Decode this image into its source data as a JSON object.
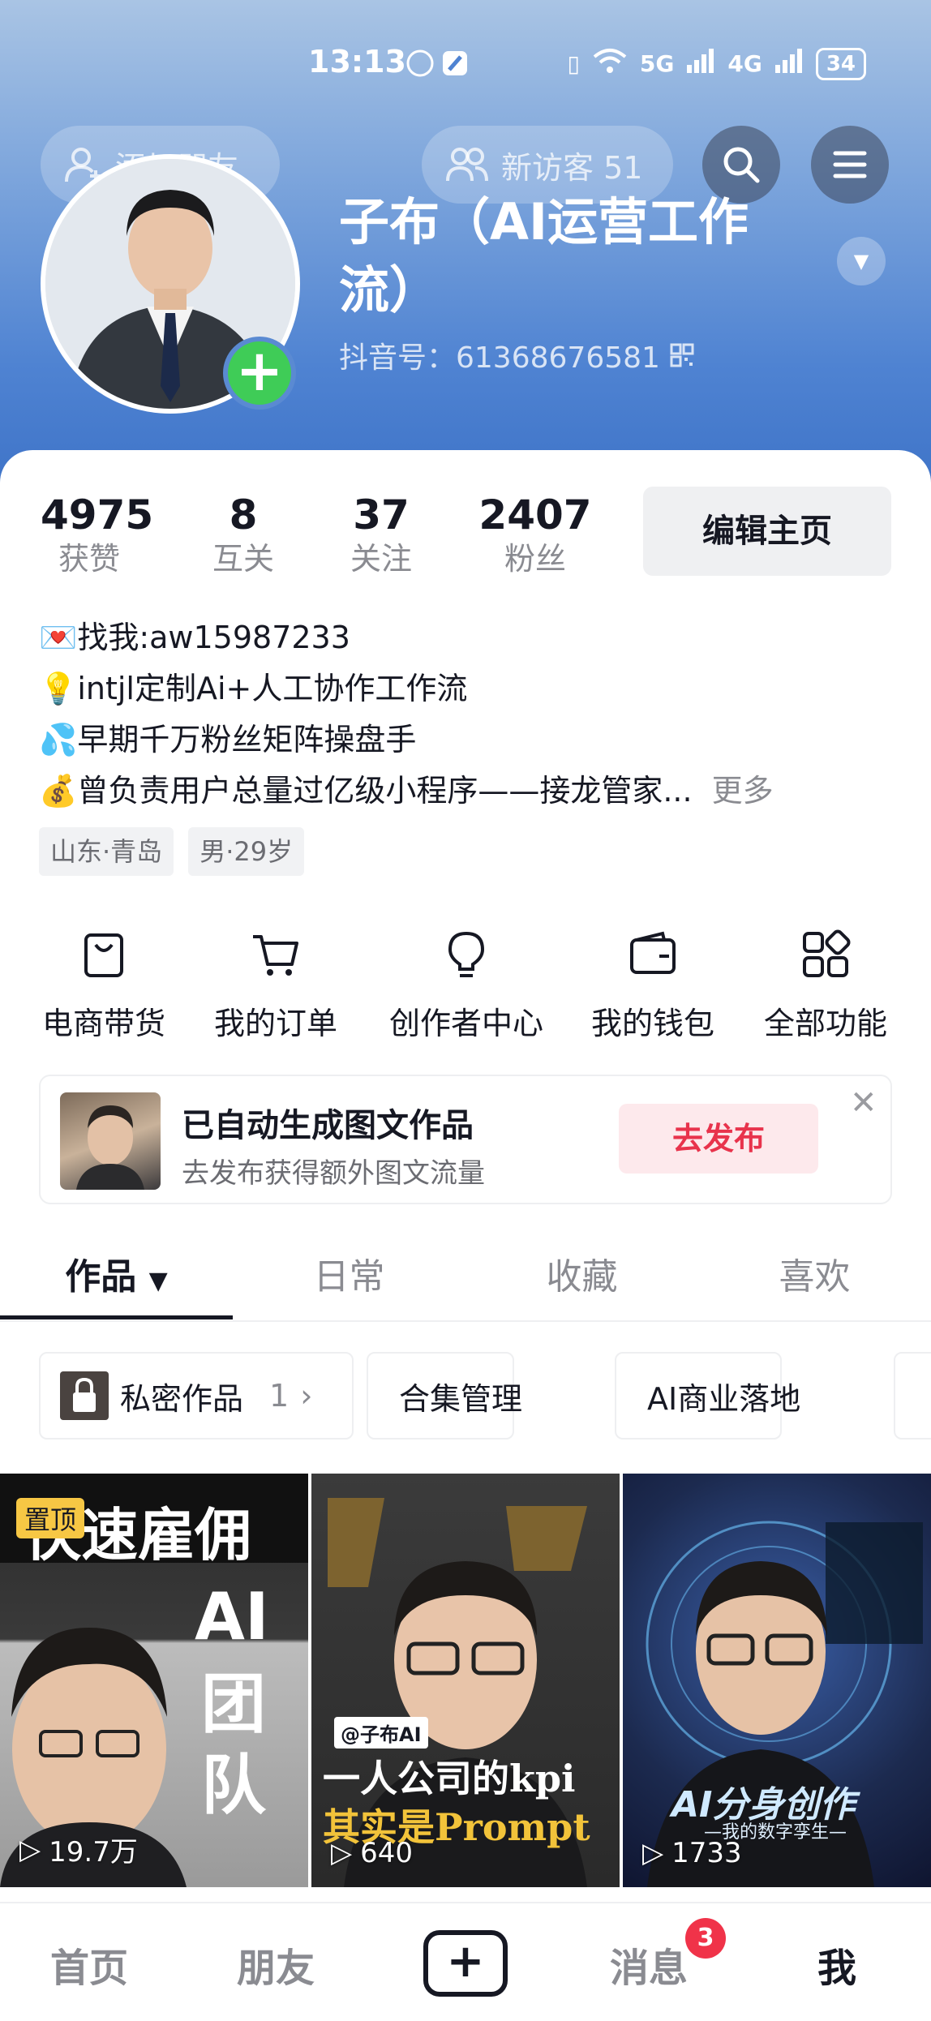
{
  "status_bar": {
    "time": "13:13",
    "network_5g": "5G",
    "network_4g": "4G",
    "battery": "34"
  },
  "header": {
    "add_friend": "添加朋友",
    "visitors": "新访客 51",
    "name": "子布（AI运营工作流）",
    "douyin_id": "抖音号：61368676581"
  },
  "stats": [
    {
      "value": "4975",
      "label": "获赞"
    },
    {
      "value": "8",
      "label": "互关"
    },
    {
      "value": "37",
      "label": "关注"
    },
    {
      "value": "2407",
      "label": "粉丝"
    }
  ],
  "edit_button": "编辑主页",
  "bio": {
    "line1": "💌找我:aw15987233",
    "line2": "💡intjl定制Ai+人工协作工作流",
    "line3": "💦早期千万粉丝矩阵操盘手",
    "line4": "💰曾负责用户总量过亿级小程序——接龙管家...",
    "more": "更多"
  },
  "tags": [
    "山东·青岛",
    "男·29岁"
  ],
  "features": [
    {
      "label": "电商带货",
      "icon": "shopping-bag-icon"
    },
    {
      "label": "我的订单",
      "icon": "cart-icon"
    },
    {
      "label": "创作者中心",
      "icon": "lightbulb-icon"
    },
    {
      "label": "我的钱包",
      "icon": "wallet-icon"
    },
    {
      "label": "全部功能",
      "icon": "grid-icon"
    }
  ],
  "notice": {
    "title": "已自动生成图文作品",
    "subtitle": "去发布获得额外图文流量",
    "button": "去发布"
  },
  "tabs": [
    "作品",
    "日常",
    "收藏",
    "喜欢"
  ],
  "chips": {
    "private": "私密作品",
    "private_count": "1",
    "collection": "合集管理",
    "ai_business": "AI商业落地"
  },
  "videos": [
    {
      "views": "19.7万",
      "pinned": "置顶",
      "text1": "快速雇佣",
      "text2": "AI",
      "text3": "团",
      "text4": "队"
    },
    {
      "views": "640",
      "tag": "@子布AI",
      "text1": "一人公司的kpi",
      "text2": "其实是Prompt"
    },
    {
      "views": "1733",
      "text1": "AI分身创作",
      "text2": "—我的数字孪生—"
    }
  ],
  "bottom_nav": {
    "home": "首页",
    "friends": "朋友",
    "messages": "消息",
    "messages_badge": "3",
    "me": "我"
  }
}
